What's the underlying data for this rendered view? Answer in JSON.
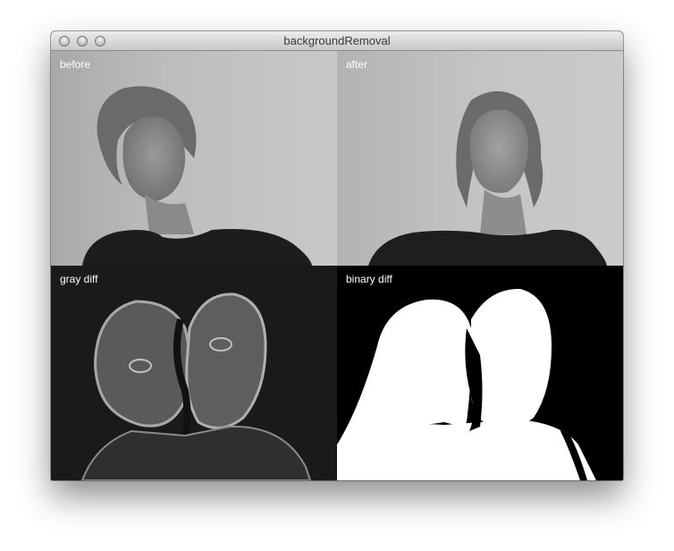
{
  "window": {
    "title": "backgroundRemoval"
  },
  "panels": {
    "before": {
      "label": "before"
    },
    "after": {
      "label": "after"
    },
    "gray_diff": {
      "label": "gray diff"
    },
    "binary_diff": {
      "label": "binary diff"
    }
  },
  "icons": {
    "close": "traffic-light-close",
    "minimize": "traffic-light-minimize",
    "zoom": "traffic-light-zoom"
  }
}
